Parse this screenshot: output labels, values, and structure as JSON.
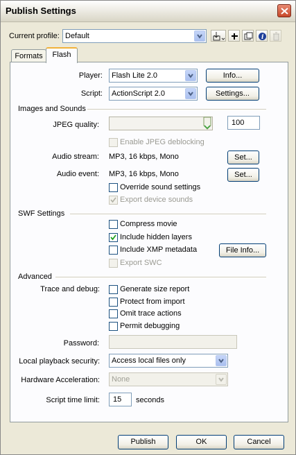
{
  "window": {
    "title": "Publish Settings"
  },
  "profile": {
    "label": "Current profile:",
    "value": "Default"
  },
  "tabs": [
    {
      "label": "Formats"
    },
    {
      "label": "Flash"
    }
  ],
  "player": {
    "label": "Player:",
    "value": "Flash Lite 2.0",
    "info_button": "Info..."
  },
  "script": {
    "label": "Script:",
    "value": "ActionScript 2.0",
    "settings_button": "Settings..."
  },
  "images_sounds": {
    "heading": "Images and Sounds",
    "jpeg_quality_label": "JPEG quality:",
    "jpeg_quality_value": "100",
    "jpeg_quality_level": 100,
    "enable_deblocking": {
      "label": "Enable JPEG deblocking",
      "checked": false,
      "enabled": false
    },
    "audio_stream": {
      "label": "Audio stream:",
      "value": "MP3, 16 kbps, Mono",
      "button": "Set..."
    },
    "audio_event": {
      "label": "Audio event:",
      "value": "MP3, 16 kbps, Mono",
      "button": "Set..."
    },
    "override_sound": {
      "label": "Override sound settings",
      "checked": false,
      "enabled": true
    },
    "export_device_sounds": {
      "label": "Export device sounds",
      "checked": true,
      "enabled": false
    }
  },
  "swf_settings": {
    "heading": "SWF Settings",
    "compress_movie": {
      "label": "Compress movie",
      "checked": false,
      "enabled": true
    },
    "include_hidden_layers": {
      "label": "Include hidden layers",
      "checked": true,
      "enabled": true
    },
    "include_xmp": {
      "label": "Include XMP metadata",
      "checked": false,
      "enabled": true
    },
    "file_info_button": "File Info...",
    "export_swc": {
      "label": "Export SWC",
      "checked": false,
      "enabled": false
    }
  },
  "advanced": {
    "heading": "Advanced",
    "trace_debug_label": "Trace and debug:",
    "generate_size_report": {
      "label": "Generate size report",
      "checked": false
    },
    "protect_from_import": {
      "label": "Protect from import",
      "checked": false
    },
    "omit_trace_actions": {
      "label": "Omit trace actions",
      "checked": false
    },
    "permit_debugging": {
      "label": "Permit debugging",
      "checked": false
    },
    "password_label": "Password:",
    "password_value": "",
    "local_playback_label": "Local playback security:",
    "local_playback_value": "Access local files only",
    "hardware_accel_label": "Hardware Acceleration:",
    "hardware_accel_value": "None",
    "script_time_label": "Script time limit:",
    "script_time_value": "15",
    "script_time_unit": "seconds"
  },
  "footer": {
    "publish": "Publish",
    "ok": "OK",
    "cancel": "Cancel"
  },
  "colors": {
    "accent_tab": "#f1b23a",
    "input_border": "#7f9db9",
    "dialog_bg": "#ece9d8"
  }
}
